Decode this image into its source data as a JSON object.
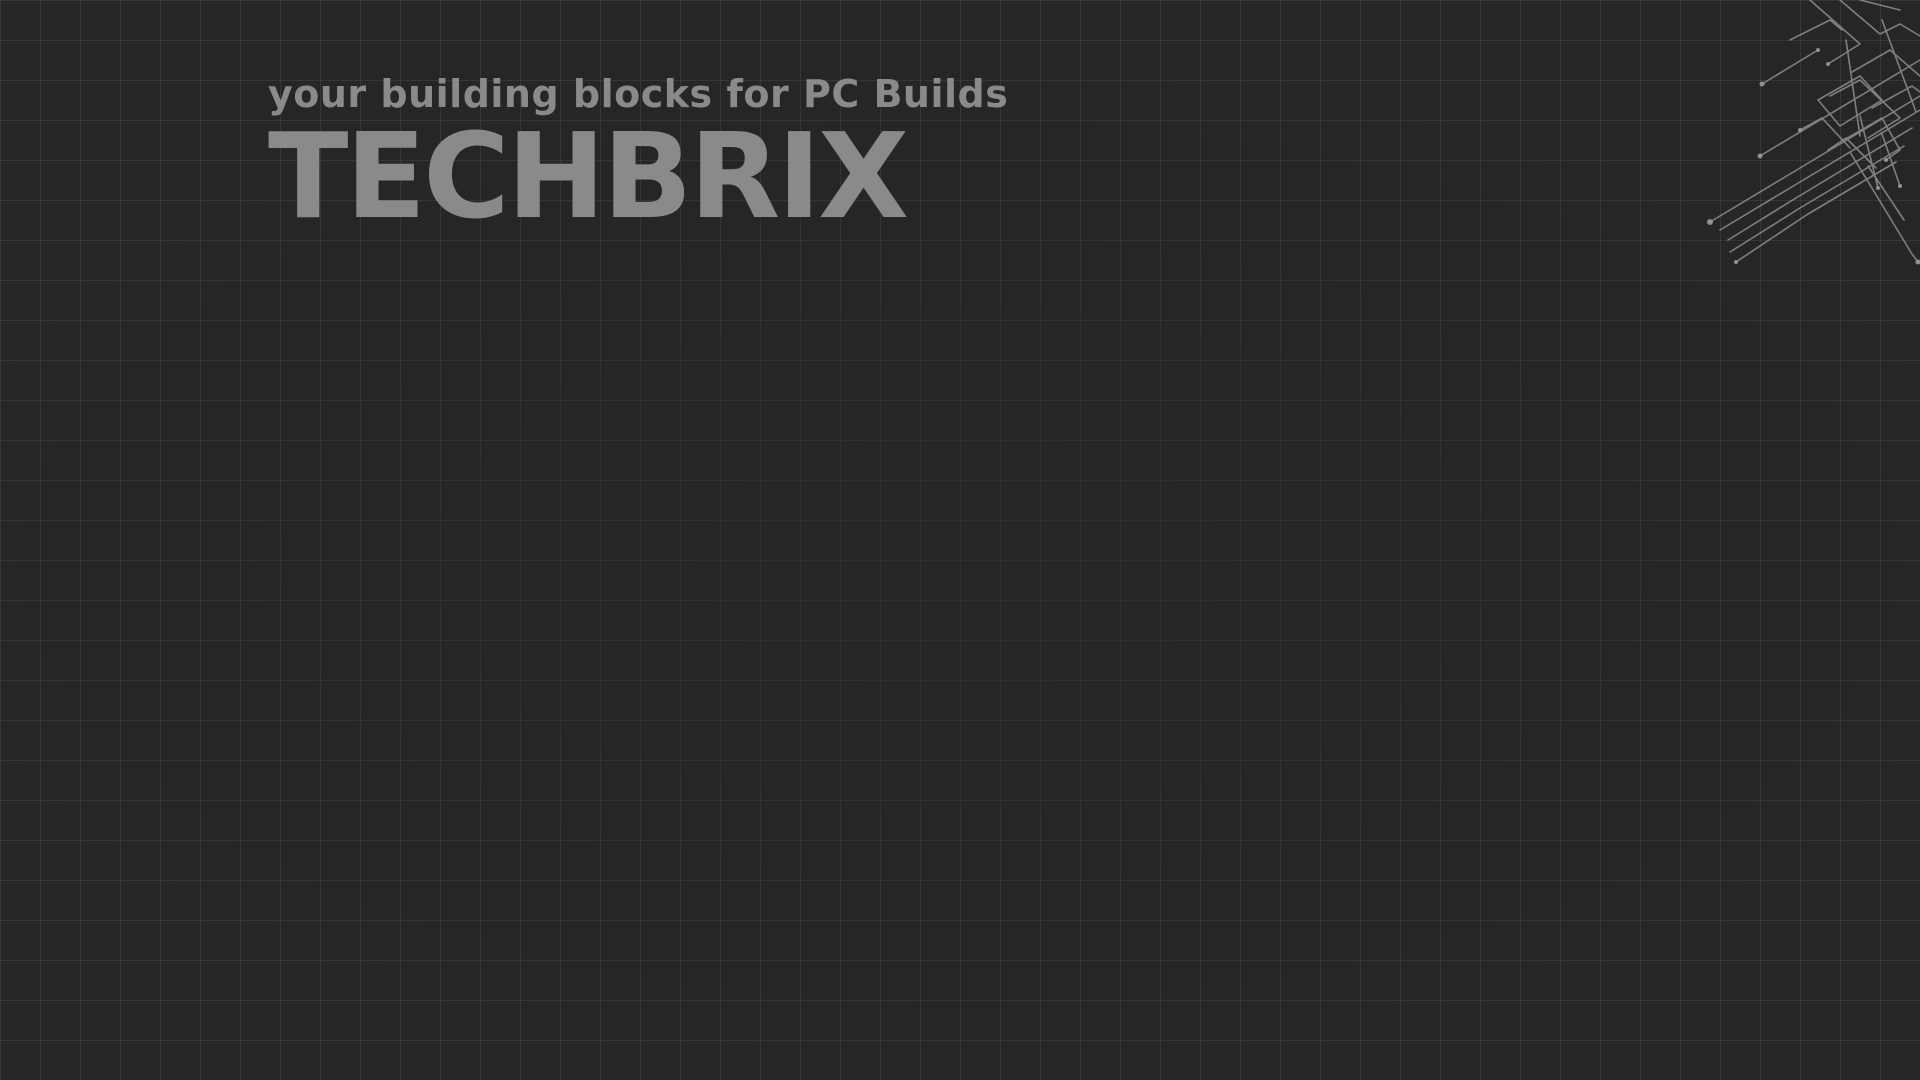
{
  "hero": {
    "tagline": "your building blocks for PC Builds",
    "title": "TECHBRIX"
  },
  "theme": {
    "background": "#262626",
    "text": "#8a8a8a",
    "grid_line": "#3a3a3a",
    "circuit_line": "#8f8f8f"
  },
  "decor": {
    "corner_graphic": "circuit-trace-icon",
    "background_pattern": "grid"
  }
}
